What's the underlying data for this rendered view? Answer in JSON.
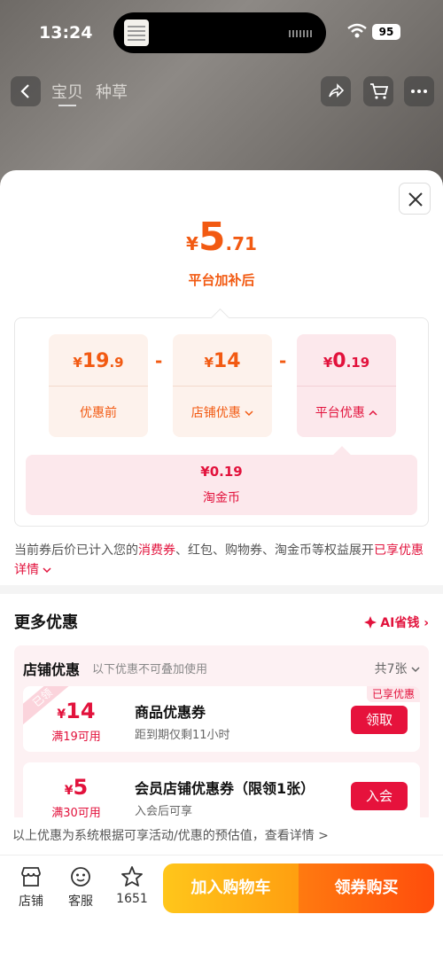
{
  "status_bar": {
    "time": "13:24",
    "battery": "95"
  },
  "nav": {
    "tab_baby": "宝贝",
    "tab_grass": "种草"
  },
  "price_sheet": {
    "currency": "¥",
    "final_int": "5",
    "final_dec": ".71",
    "final_label": "平台加补后",
    "original": {
      "int": "19",
      "dec": ".9",
      "label": "优惠前"
    },
    "store_discount": {
      "int": "14",
      "dec": "",
      "label": "店铺优惠"
    },
    "platform_discount": {
      "int": "0",
      "dec": ".19",
      "label": "平台优惠"
    },
    "minus": "-",
    "coin": {
      "amount": "¥0.19",
      "label": "淘金币"
    }
  },
  "note": {
    "part1": "当前券后价已计入您的",
    "hl1": "消费券",
    "part2": "、红包、购物券、淘金币等权益展开",
    "link": "已享优惠详情"
  },
  "more": {
    "title": "更多优惠",
    "ai_label": "AI省钱"
  },
  "store": {
    "title": "店铺优惠",
    "subtitle": "以下优惠不可叠加使用",
    "count": "共7张",
    "coupons": [
      {
        "corner": "已领",
        "tag": "已享优惠",
        "currency": "¥",
        "amount": "14",
        "condition": "满19可用",
        "name": "商品优惠券",
        "desc": "距到期仅剩11小时",
        "button": "领取"
      },
      {
        "corner": "",
        "tag": "",
        "currency": "¥",
        "amount": "5",
        "condition": "满30可用",
        "name": "会员店铺优惠券（限领1张）",
        "desc": "入会后可享",
        "button": "入会"
      }
    ]
  },
  "disclaimer": "以上优惠为系统根据可享活动/优惠的预估值，查看详情 >",
  "bottom_bar": {
    "store": "店铺",
    "service": "客服",
    "favorites": "1651",
    "add_cart": "加入购物车",
    "buy": "领券购买"
  },
  "colors": {
    "accent_orange": "#f25a12",
    "accent_red": "#e2123c"
  }
}
